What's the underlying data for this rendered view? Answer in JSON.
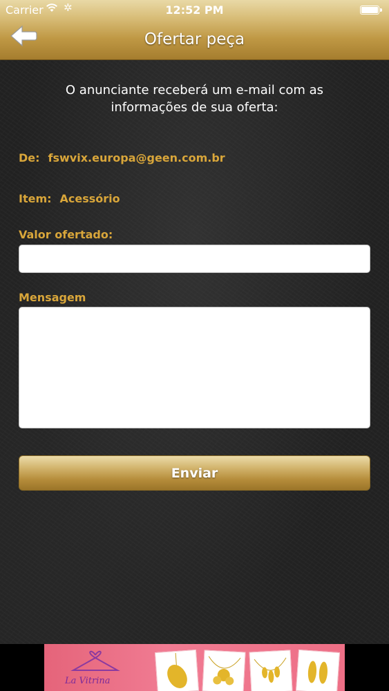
{
  "status_bar": {
    "carrier": "Carrier",
    "time": "12:52 PM"
  },
  "nav": {
    "title": "Ofertar peça",
    "back_icon": "back-arrow-icon"
  },
  "intro": "O anunciante receberá um e-mail com as informações de sua oferta:",
  "from": {
    "label": "De:",
    "value": "fswvix.europa@geen.com.br"
  },
  "item": {
    "label": "Item:",
    "value": "Acessório"
  },
  "offer_field": {
    "label": "Valor ofertado:",
    "value": ""
  },
  "message_field": {
    "label": "Mensagem",
    "value": ""
  },
  "submit_label": "Enviar",
  "ad": {
    "brand": "La Vitrina"
  },
  "colors": {
    "gold": "#d9a63a",
    "bar": "#c59f4e",
    "background": "#232323"
  }
}
